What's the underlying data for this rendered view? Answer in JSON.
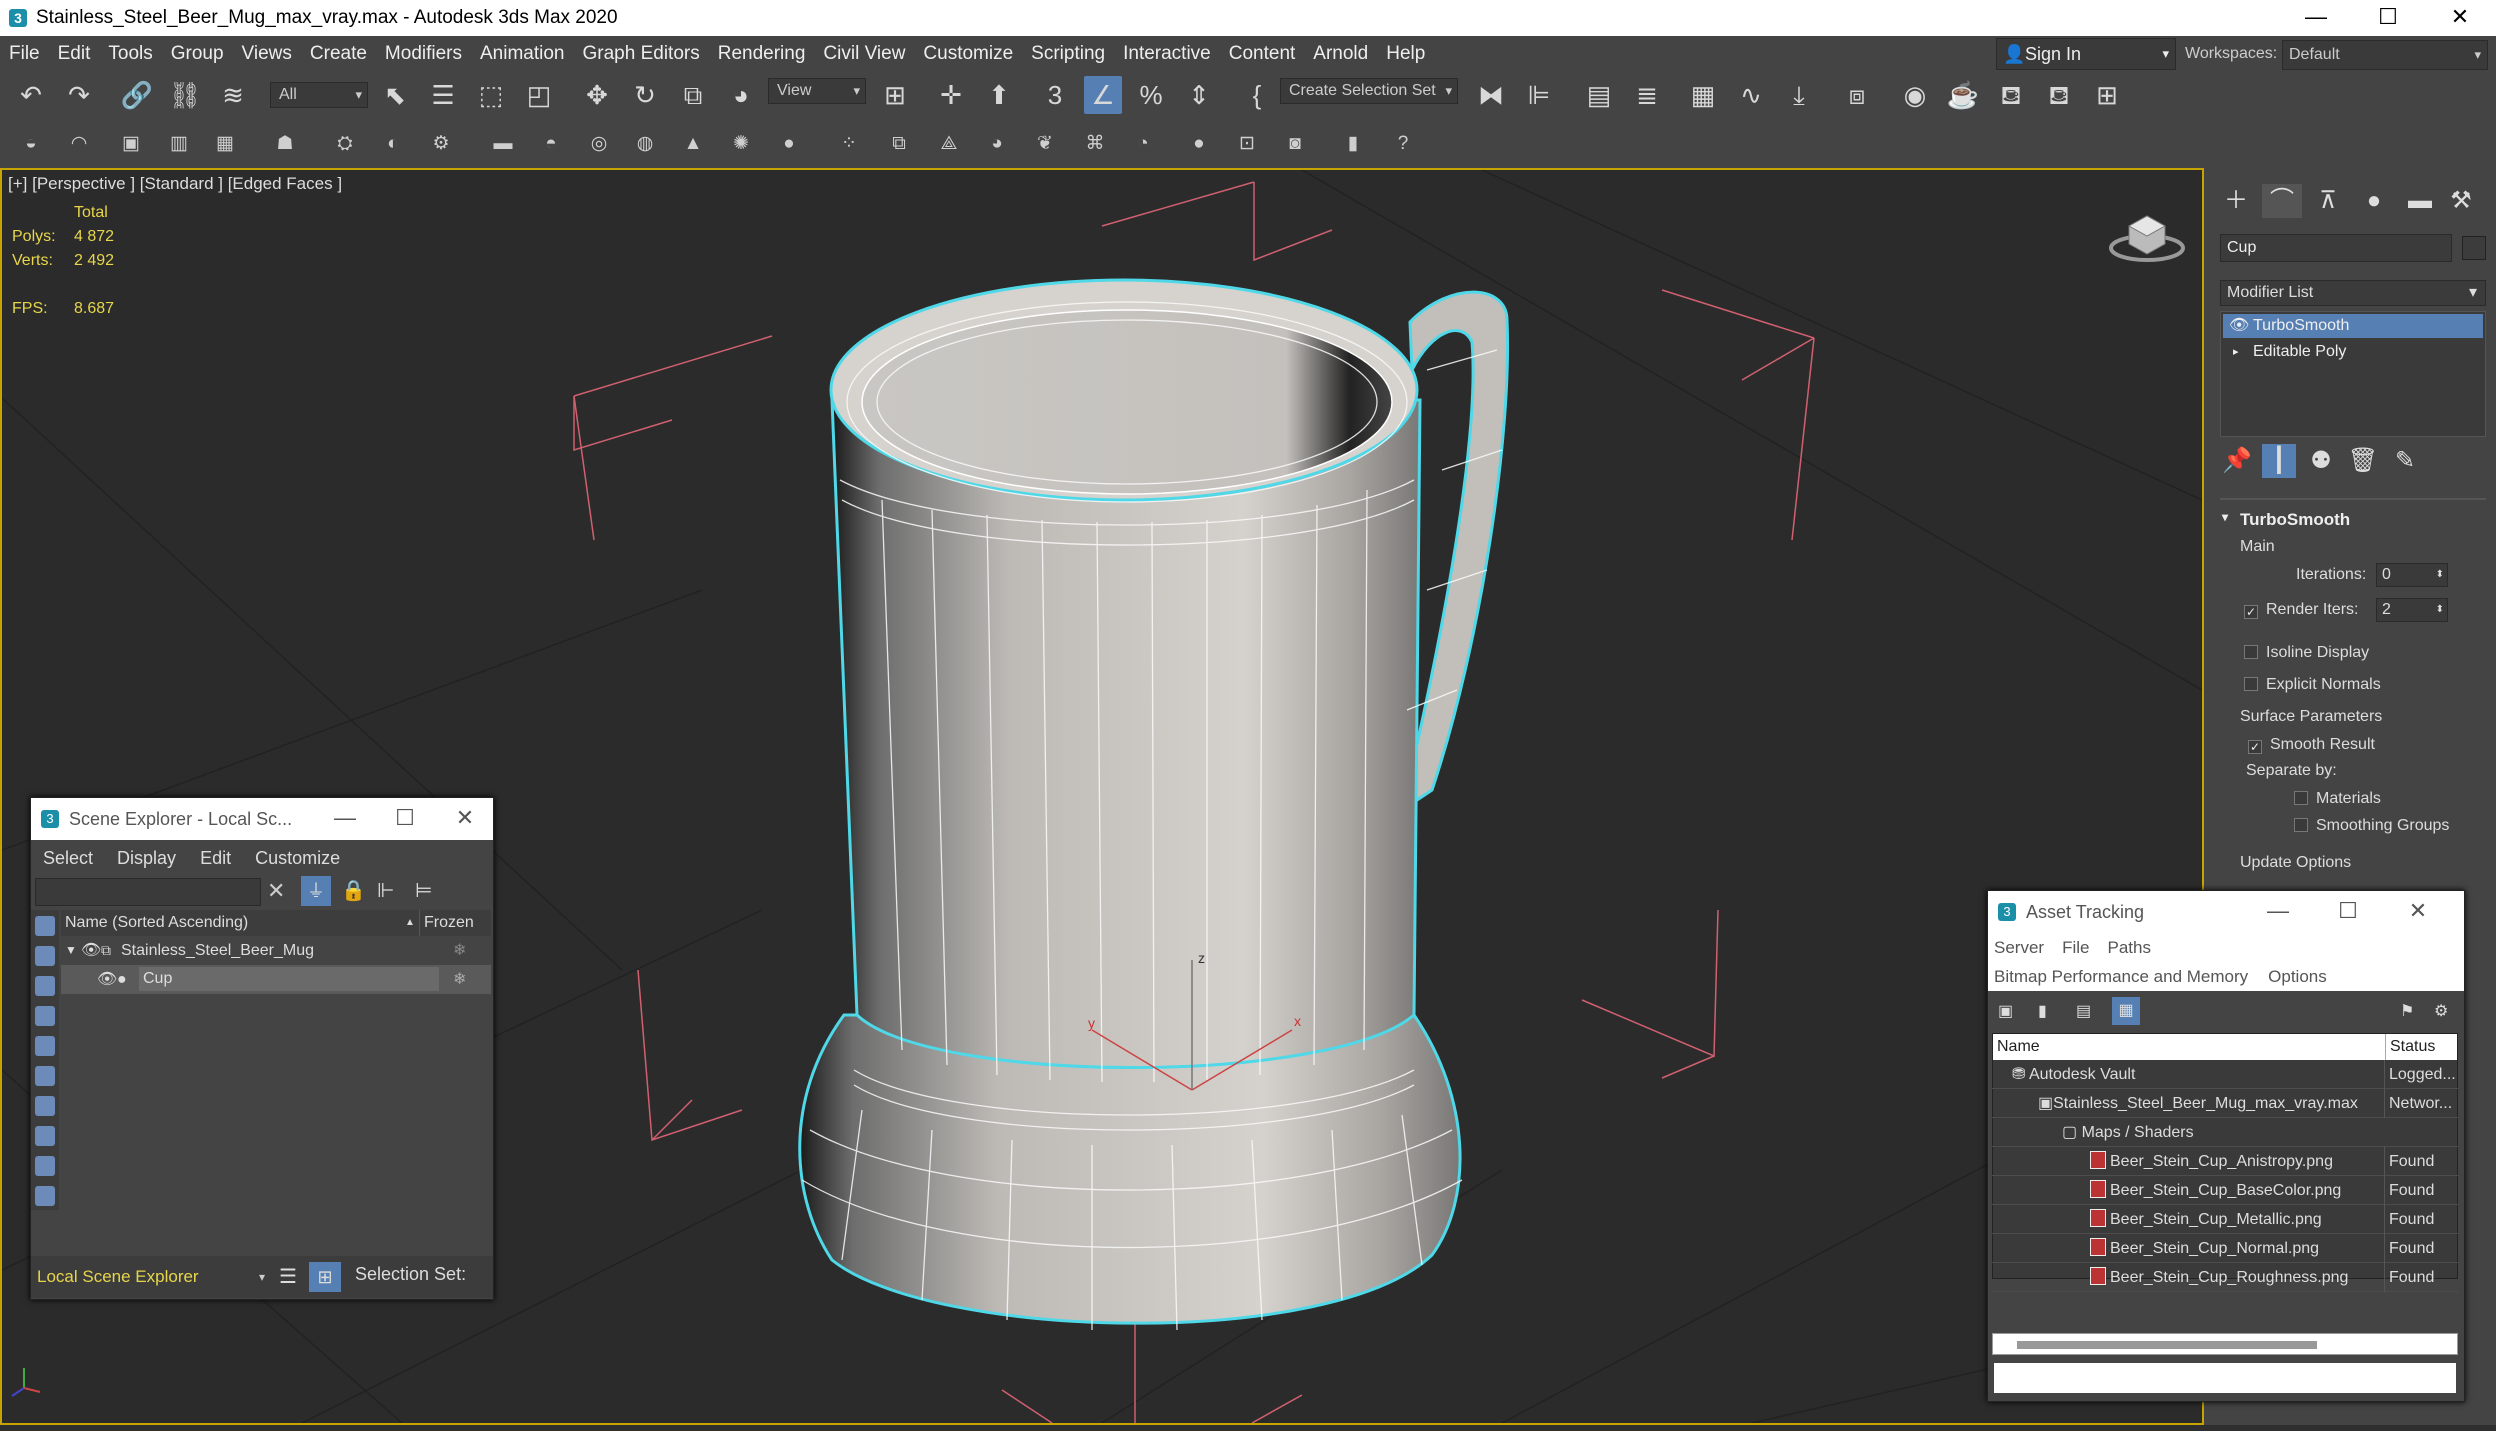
{
  "title_bar": {
    "app_icon": "3",
    "title": "Stainless_Steel_Beer_Mug_max_vray.max - Autodesk 3ds Max 2020",
    "minimize": "—",
    "maximize": "☐",
    "close": "✕"
  },
  "menu": [
    "File",
    "Edit",
    "Tools",
    "Group",
    "Views",
    "Create",
    "Modifiers",
    "Animation",
    "Graph Editors",
    "Rendering",
    "Civil View",
    "Customize",
    "Scripting",
    "Interactive",
    "Content",
    "Arnold",
    "Help"
  ],
  "signin": {
    "label": "Sign In"
  },
  "workspaces": {
    "label": "Workspaces:",
    "value": "Default"
  },
  "toolbar": {
    "filter": "All",
    "refcoord": "View",
    "selset": "Create Selection Set"
  },
  "viewport": {
    "label": "[+] [Perspective ] [Standard ] [Edged Faces ]",
    "stats": {
      "total": "Total",
      "polys_label": "Polys:",
      "polys": "4 872",
      "verts_label": "Verts:",
      "verts": "2 492",
      "fps_label": "FPS:",
      "fps": "8.687"
    },
    "gizmo": {
      "z": "z",
      "y": "y",
      "x": "x"
    }
  },
  "command_panel": {
    "object_name": "Cup",
    "modifier_list": "Modifier List",
    "stack": [
      "TurboSmooth",
      "Editable Poly"
    ],
    "rollout": "TurboSmooth",
    "main_label": "Main",
    "iterations_label": "Iterations:",
    "iterations": "0",
    "render_iters_label": "Render Iters:",
    "render_iters": "2",
    "isoline": "Isoline Display",
    "explicit_normals": "Explicit Normals",
    "surface_params": "Surface Parameters",
    "smooth_result": "Smooth Result",
    "separate_by": "Separate by:",
    "materials": "Materials",
    "smoothing_groups": "Smoothing Groups",
    "update_options": "Update Options"
  },
  "scene_explorer": {
    "title": "Scene Explorer - Local Sc...",
    "menu": [
      "Select",
      "Display",
      "Edit",
      "Customize"
    ],
    "col_name": "Name (Sorted Ascending)",
    "col_frozen": "Frozen",
    "rows": [
      {
        "name": "Stainless_Steel_Beer_Mug"
      },
      {
        "name": "Cup"
      }
    ],
    "footer_dropdown": "Local Scene Explorer",
    "selection_set": "Selection Set:"
  },
  "asset_tracking": {
    "title": "Asset Tracking",
    "menu1": [
      "Server",
      "File",
      "Paths"
    ],
    "menu2": [
      "Bitmap Performance and Memory",
      "Options"
    ],
    "col_name": "Name",
    "col_status": "Status",
    "rows": [
      {
        "name": "Autodesk Vault",
        "status": "Logged..."
      },
      {
        "name": "Stainless_Steel_Beer_Mug_max_vray.max",
        "status": "Networ..."
      },
      {
        "name": "Maps / Shaders",
        "status": ""
      },
      {
        "name": "Beer_Stein_Cup_Anistropy.png",
        "status": "Found"
      },
      {
        "name": "Beer_Stein_Cup_BaseColor.png",
        "status": "Found"
      },
      {
        "name": "Beer_Stein_Cup_Metallic.png",
        "status": "Found"
      },
      {
        "name": "Beer_Stein_Cup_Normal.png",
        "status": "Found"
      },
      {
        "name": "Beer_Stein_Cup_Roughness.png",
        "status": "Found"
      }
    ]
  },
  "colors": {
    "selection": "#5680b4",
    "viewport_border": "#c8a400",
    "wire_highlight": "#4fd8e8",
    "stats": "#e7d64b"
  }
}
